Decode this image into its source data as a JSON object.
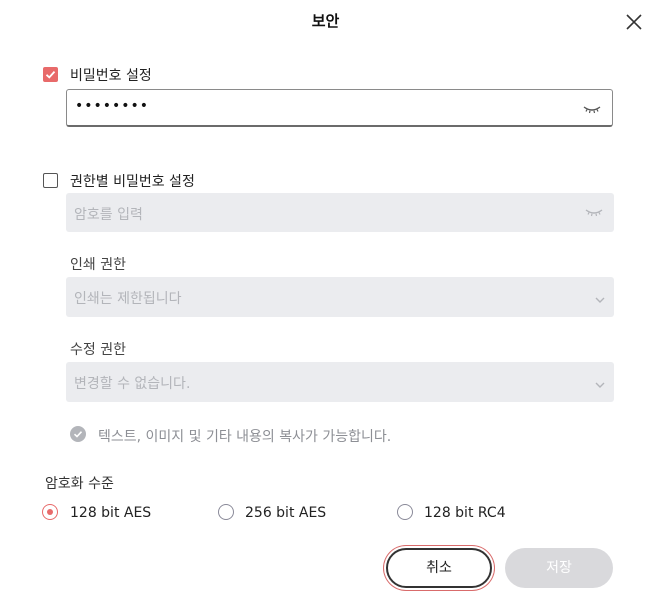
{
  "dialog": {
    "title": "보안"
  },
  "password": {
    "label": "비밀번호 설정",
    "checked": true,
    "value": "••••••••"
  },
  "permission_password": {
    "label": "권한별 비밀번호 설정",
    "checked": false,
    "placeholder": "암호를 입력",
    "print": {
      "label": "인쇄 권한",
      "selected": "인쇄는 제한됩니다"
    },
    "edit": {
      "label": "수정 권한",
      "selected": "변경할 수 없습니다."
    },
    "copy_note": "텍스트, 이미지 및 기타 내용의 복사가 가능합니다."
  },
  "encryption": {
    "label": "암호화 수준",
    "options": [
      {
        "label": "128 bit AES",
        "selected": true
      },
      {
        "label": "256 bit AES",
        "selected": false
      },
      {
        "label": "128 bit RC4",
        "selected": false
      }
    ]
  },
  "buttons": {
    "cancel": "취소",
    "save": "저장"
  },
  "colors": {
    "accent": "#e86a6a",
    "disabled_bg": "#ebecef",
    "save_bg": "#d9d9dc"
  }
}
